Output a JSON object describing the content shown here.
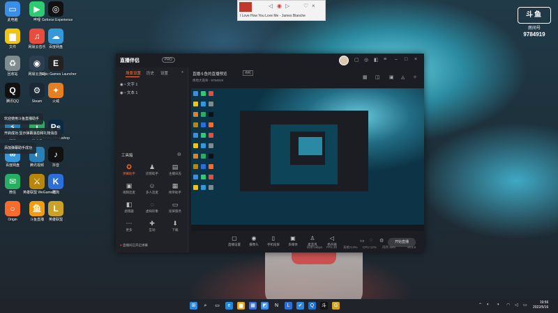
{
  "watermark": {
    "logo": "斗鱼",
    "sub": "房间号",
    "room_number": "9784919"
  },
  "music": {
    "song": "I Love How You Love Me - James Blanche"
  },
  "desktop_icons": [
    {
      "label": "此电脑",
      "icon": "pc-icon",
      "color": "#3a8ee6",
      "glyph": "▭"
    },
    {
      "label": "哔哩",
      "icon": "bilibili-icon",
      "color": "#2ecc71",
      "glyph": "▶"
    },
    {
      "label": "Geforce Experience",
      "icon": "nvidia-icon",
      "color": "#111111",
      "glyph": "◎"
    },
    {
      "label": "文件",
      "icon": "folder-icon",
      "color": "#f1c40f",
      "glyph": "▆"
    },
    {
      "label": "网易云音乐",
      "icon": "music-icon",
      "color": "#e74c3c",
      "glyph": "♫"
    },
    {
      "label": "百度网盘",
      "icon": "cloud-icon",
      "color": "#3498db",
      "glyph": "☁"
    },
    {
      "label": "回收站",
      "icon": "recycle-icon",
      "color": "#7f8c8d",
      "glyph": "♻"
    },
    {
      "label": "网易云游戏",
      "icon": "game-icon",
      "color": "#2c3e50",
      "glyph": "◉"
    },
    {
      "label": "Epic Games Launcher",
      "icon": "epic-icon",
      "color": "#222222",
      "glyph": "E"
    },
    {
      "label": "腾讯QQ",
      "icon": "qq-icon",
      "color": "#111111",
      "glyph": "Q"
    },
    {
      "label": "Steam",
      "icon": "steam-icon",
      "color": "#1b2838",
      "glyph": "⚙"
    },
    {
      "label": "火绒",
      "icon": "huorong-icon",
      "color": "#e67e22",
      "glyph": "✦"
    },
    {
      "label": "迅雷",
      "icon": "thunder-icon",
      "color": "#2980b9",
      "glyph": "⚡"
    },
    {
      "label": "爱奇艺",
      "icon": "iqiyi-icon",
      "color": "#27ae60",
      "glyph": "i"
    },
    {
      "label": "Adobe Photoshop",
      "icon": "ps-icon",
      "color": "#0b2a46",
      "glyph": "Ps"
    },
    {
      "label": "百度网盘",
      "icon": "baidu-icon",
      "color": "#3498db",
      "glyph": "∞"
    },
    {
      "label": "腾讯视频",
      "icon": "tv-icon",
      "color": "#2980b9",
      "glyph": "◐"
    },
    {
      "label": "抖音",
      "icon": "tiktok-icon",
      "color": "#111111",
      "glyph": "♪"
    },
    {
      "label": "微信",
      "icon": "wechat-icon",
      "color": "#27ae60",
      "glyph": "✉"
    },
    {
      "label": "英雄联盟 WeGame版",
      "icon": "lol-icon",
      "color": "#b8860b",
      "glyph": "⚔"
    },
    {
      "label": "酷狗",
      "icon": "kugou-icon",
      "color": "#2a6fdb",
      "glyph": "K"
    },
    {
      "label": "Origin",
      "icon": "origin-icon",
      "color": "#f56c2d",
      "glyph": "○"
    },
    {
      "label": "斗鱼直播",
      "icon": "douyu-icon",
      "color": "#f39c12",
      "glyph": "鱼"
    },
    {
      "label": "英雄联盟",
      "icon": "lol2-icon",
      "color": "#c9a227",
      "glyph": "L"
    }
  ],
  "notifications": [
    {
      "text": "欢迎使用斗鱼直播助手"
    },
    {
      "text": "开启成功 显示弹幕消息和礼物消息"
    },
    {
      "text": "添加弹幕助手成功"
    }
  ],
  "app": {
    "logo": "直播伴侣",
    "version": "PRO"
  },
  "left": {
    "tabs": [
      "场景设置",
      "历史",
      "设置"
    ],
    "sources": [
      "文字 1",
      "文本 1"
    ],
    "tools_header": "工具箱",
    "tools": [
      {
        "label": "弹幕助手",
        "icon": "danmaku-icon",
        "glyph": "✪",
        "hot": true
      },
      {
        "label": "房管助手",
        "icon": "admin-icon",
        "glyph": "♟",
        "hot": false
      },
      {
        "label": "主播日志",
        "icon": "log-icon",
        "glyph": "▤",
        "hot": false
      },
      {
        "label": "视频连麦",
        "icon": "video-icon",
        "glyph": "▣",
        "hot": false
      },
      {
        "label": "多人连麦",
        "icon": "multi-icon",
        "glyph": "☺",
        "hot": false
      },
      {
        "label": "榜单助手",
        "icon": "rank-icon",
        "glyph": "▦",
        "hot": false
      },
      {
        "label": "滤镜器",
        "icon": "filter-icon",
        "glyph": "◧",
        "hot": false
      },
      {
        "label": "虚拟形象",
        "icon": "avatar-tool-icon",
        "glyph": "◌",
        "hot": false
      },
      {
        "label": "投屏服务",
        "icon": "cast-icon",
        "glyph": "▭",
        "hot": false
      },
      {
        "label": "更多",
        "icon": "more-icon",
        "glyph": "⋯",
        "hot": false
      },
      {
        "label": "互动",
        "icon": "interact-icon",
        "glyph": "✚",
        "hot": false
      },
      {
        "label": "下载",
        "icon": "download-icon",
        "glyph": "⬇",
        "hot": false
      }
    ],
    "status": "直播间已开启弹幕"
  },
  "right": {
    "room_title": "直播斗鱼的直播预览",
    "room_tag": "待机",
    "room_info": "绝地大逃杀 · 9784919",
    "controls": [
      {
        "label": "直播设置",
        "icon": "screen-icon",
        "glyph": "▢"
      },
      {
        "label": "摄像头",
        "icon": "camera-icon",
        "glyph": "◉"
      },
      {
        "label": "手机投屏",
        "icon": "phone-icon",
        "glyph": "▯"
      },
      {
        "label": "多媒体",
        "icon": "media-icon",
        "glyph": "▣"
      },
      {
        "label": "麦克风",
        "icon": "mic-icon",
        "glyph": "♙"
      },
      {
        "label": "扬声器",
        "icon": "speaker-icon",
        "glyph": "◁"
      }
    ],
    "go_live": "开始直播",
    "status_items": [
      "码率:0kbps",
      "FPS:30",
      "丢帧:0.0%",
      "CPU:12%",
      "内存:45%",
      "v8.5.6"
    ]
  },
  "taskbar": {
    "icons": [
      {
        "icon": "windows-icon",
        "glyph": "⊞",
        "color": "#2b87e0"
      },
      {
        "icon": "search-icon",
        "glyph": "⌕",
        "color": "#20242a"
      },
      {
        "icon": "taskview-icon",
        "glyph": "▭",
        "color": "#20242a"
      },
      {
        "icon": "edge-icon",
        "glyph": "e",
        "color": "#1e88e5"
      },
      {
        "icon": "explorer-icon",
        "glyph": "▆",
        "color": "#e6a817"
      },
      {
        "icon": "store-icon",
        "glyph": "▦",
        "color": "#3a6fd8"
      },
      {
        "icon": "photos-icon",
        "glyph": "◩",
        "color": "#3d8ae6"
      },
      {
        "icon": "notion-icon",
        "glyph": "N",
        "color": "#20242a"
      },
      {
        "icon": "lark-icon",
        "glyph": "L",
        "color": "#2a6fdb"
      },
      {
        "icon": "wechat-task-icon",
        "glyph": "✔",
        "color": "#2b87e0"
      },
      {
        "icon": "qq-task-icon",
        "glyph": "Q",
        "color": "#1e6fcf"
      },
      {
        "icon": "douyu-task-icon",
        "glyph": "斗",
        "color": "#111111"
      },
      {
        "icon": "game-task-icon",
        "glyph": "G",
        "color": "#d8a320"
      }
    ],
    "time": "19:56",
    "date": "2022/5/16"
  }
}
